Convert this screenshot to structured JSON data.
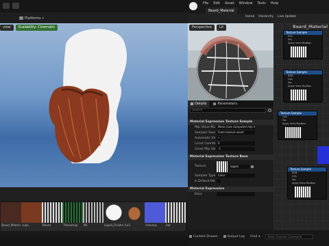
{
  "left_top": {
    "tab_platforms": "Platforms",
    "viewport_buttons": [
      "view",
      "Scalability: Cinematic"
    ]
  },
  "content_browser": {
    "thumbnails": [
      {
        "label": "Beard_Material",
        "color": "#4a2a20"
      },
      {
        "label": "cuba",
        "color": "#7a3a22"
      },
      {
        "label": "Beard",
        "color": "#8a8a8a"
      },
      {
        "label": "Thenomap",
        "color": "#1f3b2a"
      },
      {
        "label": "M1",
        "color": "#555555"
      },
      {
        "label": "Liquid_Finisher",
        "color": "#dddddd"
      },
      {
        "label": "fur1",
        "color": "#6b3a25"
      },
      {
        "label": "cheveux",
        "color": "#4f5ad8"
      },
      {
        "label": "Aut",
        "color": "#444444"
      }
    ]
  },
  "right_window": {
    "menu": [
      "File",
      "Edit",
      "Asset",
      "Window",
      "Tools",
      "Help"
    ],
    "tab_title": "Beard_Material",
    "toolbar": [
      "Home",
      "Hierarchy",
      "Live Update"
    ],
    "preview_buttons": [
      "Perspective",
      "Lit"
    ],
    "graph_title": "Beard_Material",
    "details_tab": "Details",
    "parameters_tab": "Parameters",
    "search_placeholder": "Search",
    "sections": {
      "texture_sample": "Material Expression Texture Sample",
      "texture_base": "Material Expression Texture Base",
      "expression": "Material Expression"
    },
    "rows": [
      {
        "key": "Mip Value Mode",
        "value": "None (use computed mip le"
      },
      {
        "key": "Sampler Source",
        "value": "From texture asset"
      },
      {
        "key": "Automatic View Mip B",
        "value": "✔"
      },
      {
        "key": "Const Coordinate",
        "value": "0"
      },
      {
        "key": "Const Mip Value",
        "value": "-1"
      }
    ],
    "texture_label": "Texture",
    "texture_value": "lagom",
    "sampler_type_label": "Sampler Type",
    "sampler_type_value": "Color",
    "is_default_label": "Is Default Meshpaint",
    "desc_label": "Desc",
    "node_title": "Texture Sample",
    "node_pins": [
      "UVs",
      "Tex",
      "Apply View MipBias"
    ],
    "node_outputs": [
      "RGB",
      "R",
      "G",
      "B",
      "A",
      "RGBA"
    ],
    "bottom": {
      "content_drawer": "Content Drawer",
      "output_log": "Output Log",
      "cmd": "Cmd",
      "cmd_placeholder": "Enter Console Command"
    }
  }
}
